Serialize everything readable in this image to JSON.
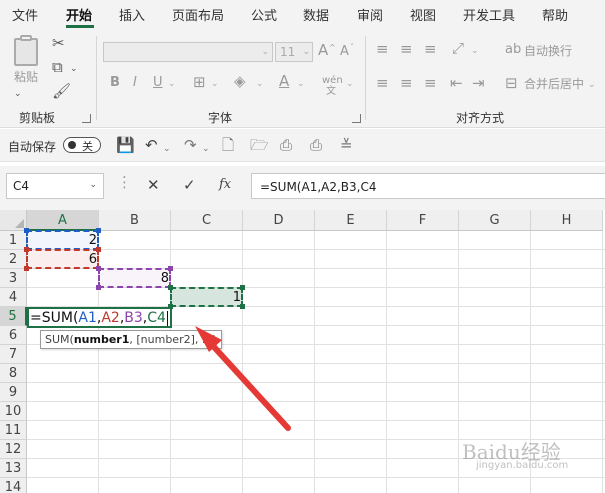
{
  "menu": [
    "文件",
    "开始",
    "插入",
    "页面布局",
    "公式",
    "数据",
    "审阅",
    "视图",
    "开发工具",
    "帮助"
  ],
  "active_tab": "开始",
  "ribbon": {
    "clipboard": {
      "paste_label": "粘贴",
      "group_label": "剪贴板"
    },
    "font": {
      "name_value": "",
      "size_value": "11",
      "group_label": "字体",
      "bold": "B",
      "italic": "I",
      "underline": "U",
      "grow": "A",
      "shrink": "A",
      "wen": "wén"
    },
    "alignment": {
      "wrap_label": "自动换行",
      "merge_label": "合并后居中",
      "group_label": "对齐方式"
    }
  },
  "quick_access": {
    "autosave_label": "自动保存",
    "toggle_state": "关"
  },
  "formula_bar": {
    "name_box": "C4",
    "fx_label": "fx",
    "formula": "=SUM(A1,A2,B3,C4"
  },
  "columns": [
    "A",
    "B",
    "C",
    "D",
    "E",
    "F",
    "G",
    "H"
  ],
  "rows": [
    "1",
    "2",
    "3",
    "4",
    "5",
    "6",
    "7",
    "8",
    "9",
    "10",
    "11",
    "12",
    "13",
    "14"
  ],
  "cells": {
    "A1": "2",
    "A2": "6",
    "B3": "8",
    "C4": "1"
  },
  "editing": {
    "cell": "A5",
    "tokens": [
      {
        "text": "=SUM(",
        "color": "#111111"
      },
      {
        "text": "A1",
        "color": "#1f5fc4"
      },
      {
        "text": ",",
        "color": "#111111"
      },
      {
        "text": "A2",
        "color": "#c0392b"
      },
      {
        "text": ",",
        "color": "#111111"
      },
      {
        "text": "B3",
        "color": "#8e44ad"
      },
      {
        "text": ",",
        "color": "#111111"
      },
      {
        "text": "C4",
        "color": "#1e7145"
      }
    ]
  },
  "tooltip": {
    "prefix": "SUM(",
    "bold_arg": "number1",
    "rest": ", [number2], ...)"
  },
  "ref_colors": {
    "A1": "#1f5fc4",
    "A2": "#c0392b",
    "B3": "#8e44ad",
    "C4": "#1e7145"
  },
  "watermark": {
    "main": "Baidu经验",
    "sub": "jingyan.baidu.com"
  }
}
